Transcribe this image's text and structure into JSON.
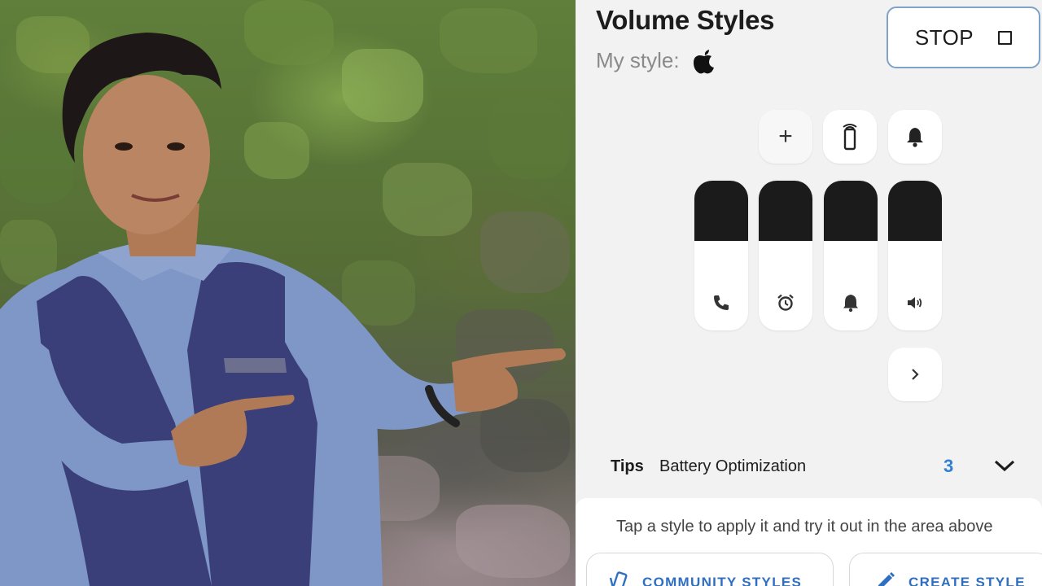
{
  "app": {
    "title": "Volume Styles",
    "my_style_label": "My style:",
    "my_style_icon": "apple-logo-icon",
    "stop_button": {
      "label": "STOP",
      "icon": "stop-square-icon"
    }
  },
  "controls": {
    "top_buttons": [
      {
        "name": "add-button",
        "icon": "plus-icon"
      },
      {
        "name": "vibrate-button",
        "icon": "vibrate-phone-icon"
      },
      {
        "name": "bell-button",
        "icon": "bell-icon"
      }
    ],
    "sliders": [
      {
        "name": "call-volume-slider",
        "icon": "phone-icon",
        "level": 0.6
      },
      {
        "name": "alarm-volume-slider",
        "icon": "alarm-clock-icon",
        "level": 0.6
      },
      {
        "name": "ring-volume-slider",
        "icon": "bell-icon",
        "level": 0.6
      },
      {
        "name": "media-volume-slider",
        "icon": "speaker-icon",
        "level": 0.6
      }
    ],
    "next_button": {
      "icon": "chevron-right-icon"
    }
  },
  "tips": {
    "label": "Tips",
    "text": "Battery Optimization",
    "count": "3",
    "expand_icon": "chevron-down-icon"
  },
  "sheet": {
    "hint": "Tap a style to apply it and try it out in the area above",
    "community_styles_label": "COMMUNITY STYLES",
    "create_style_label": "CREATE STYLE"
  },
  "colors": {
    "accent": "#2f7fd6",
    "button_text_blue": "#2f6fc2",
    "stop_border": "#7fa2c9",
    "slider_dark": "#1b1b1b",
    "panel_bg": "#f2f2f2"
  }
}
